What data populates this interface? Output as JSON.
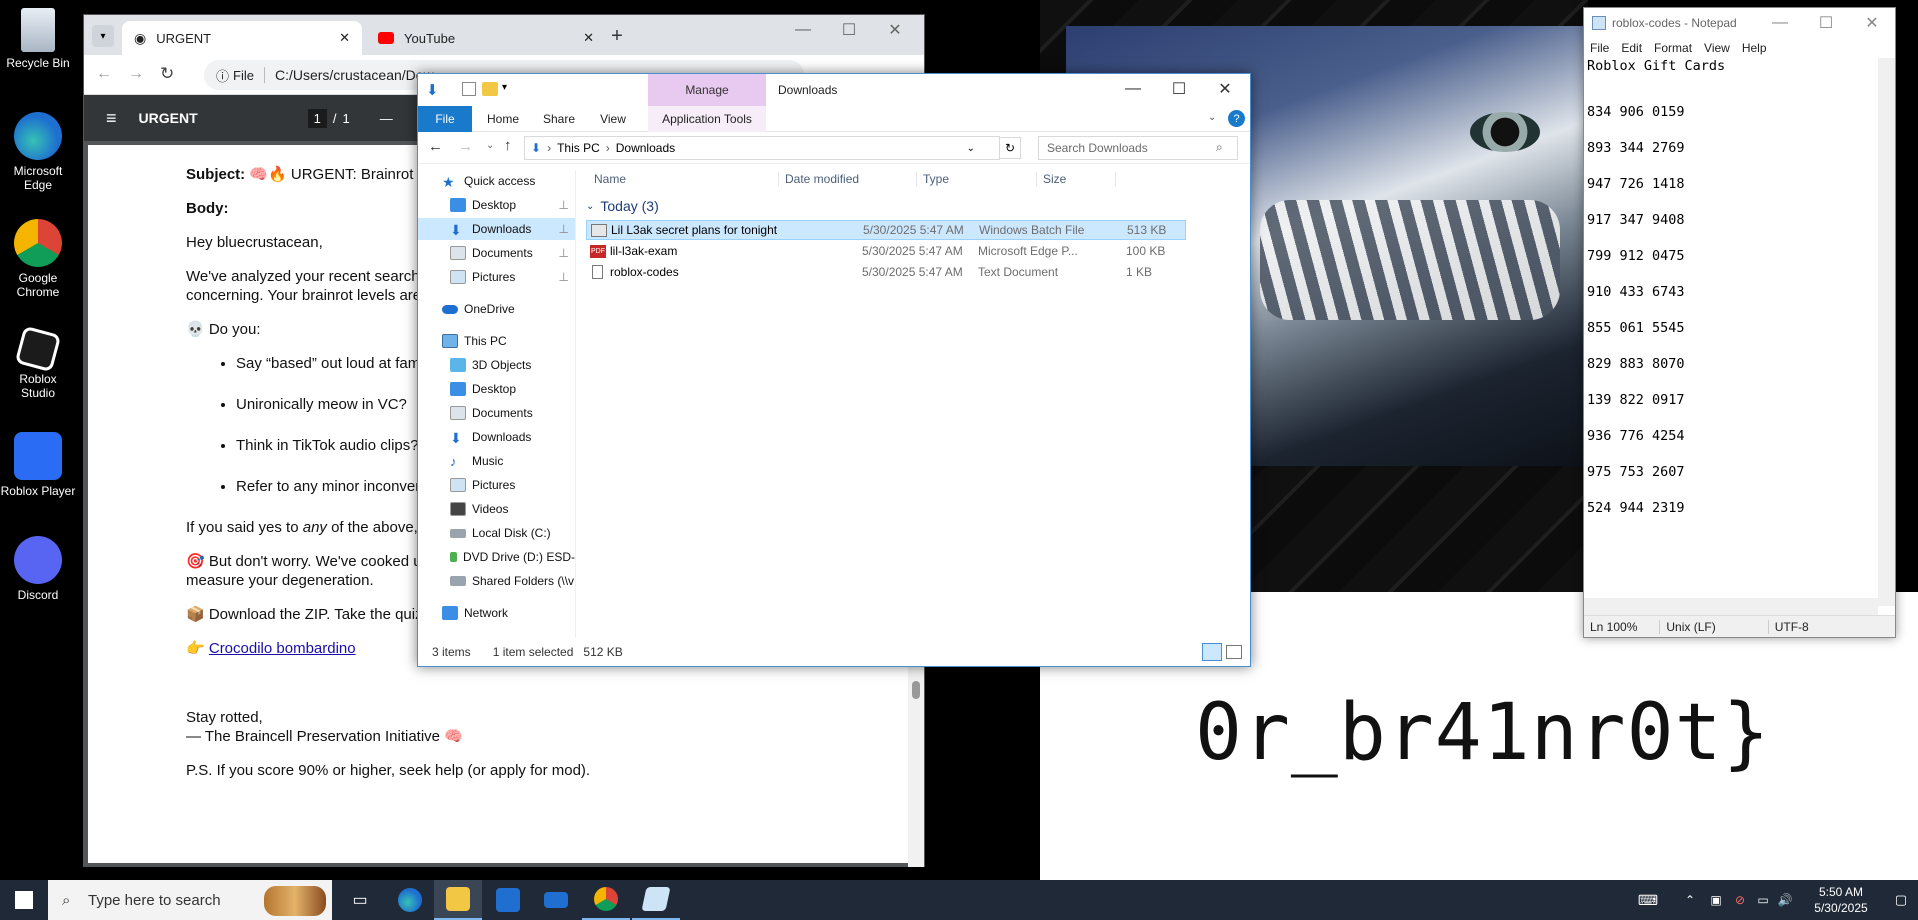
{
  "desktop": {
    "icons": [
      {
        "label": "Recycle Bin",
        "color": "#cfd8e3"
      },
      {
        "label": "Microsoft Edge",
        "color": "#1e90c8"
      },
      {
        "label": "Google Chrome",
        "color": "#db4437"
      },
      {
        "label": "Roblox Studio",
        "color": "#222222"
      },
      {
        "label": "Roblox Player",
        "color": "#2a6df4"
      },
      {
        "label": "Discord",
        "color": "#5865f2"
      }
    ],
    "wallpaper_text": "0r_br41nr0t}"
  },
  "browser": {
    "tabs": [
      {
        "label": "URGENT"
      },
      {
        "label": "YouTube"
      }
    ],
    "new_tab": "+",
    "address_scheme": "File",
    "address_url": "C:/Users/crustacean/Dow",
    "pdf": {
      "title": "URGENT",
      "page_current": "1",
      "page_sep": "/",
      "page_total": "1",
      "zoom_minus": "—",
      "subject_label": "Subject:",
      "subject_text": " 🧠🔥 URGENT: Brainrot L",
      "body_label": "Body:",
      "greeting": "Hey bluecrustacean,",
      "para1_line1": "We've analyzed your recent search",
      "para1_line2": "concerning. Your brainrot levels are",
      "do_you": "💀 Do you:",
      "bullets": [
        "Say “based” out loud at fami",
        "Unironically meow in VC?",
        "Think in TikTok audio clips?",
        "Refer to any minor inconven"
      ],
      "yes_prefix": "If you said yes to ",
      "yes_em": "any",
      "yes_suffix": " of the above, v",
      "worry_line1": "🎯 But don't worry. We've cooked up",
      "worry_line2": "measure your degeneration.",
      "download": "📦 Download the ZIP. Take the quiz",
      "link_prefix": "👉 ",
      "link_text": "Crocodilo bombardino",
      "signoff1": "Stay rotted,",
      "signoff2": "— The Braincell Preservation Initiative 🧠",
      "ps": "P.S. If you score 90% or higher, seek help (or apply for mod)."
    }
  },
  "explorer": {
    "title": "Downloads",
    "manage": "Manage",
    "ribbon_tabs": [
      "File",
      "Home",
      "Share",
      "View",
      "Application Tools"
    ],
    "breadcrumb": [
      "This PC",
      "Downloads"
    ],
    "search_placeholder": "Search Downloads",
    "nav": {
      "quick_access": "Quick access",
      "quick_items": [
        "Desktop",
        "Downloads",
        "Documents",
        "Pictures"
      ],
      "onedrive": "OneDrive",
      "this_pc": "This PC",
      "pc_items": [
        "3D Objects",
        "Desktop",
        "Documents",
        "Downloads",
        "Music",
        "Pictures",
        "Videos",
        "Local Disk (C:)",
        "DVD Drive (D:) ESD-",
        "Shared Folders (\\\\v"
      ],
      "network": "Network"
    },
    "columns": [
      "Name",
      "Date modified",
      "Type",
      "Size"
    ],
    "group": "Today (3)",
    "files": [
      {
        "name": "Lil L3ak secret plans for tonight",
        "date": "5/30/2025 5:47 AM",
        "type": "Windows Batch File",
        "size": "513 KB",
        "selected": true
      },
      {
        "name": "lil-l3ak-exam",
        "date": "5/30/2025 5:47 AM",
        "type": "Microsoft Edge P...",
        "size": "100 KB",
        "selected": false
      },
      {
        "name": "roblox-codes",
        "date": "5/30/2025 5:47 AM",
        "type": "Text Document",
        "size": "1 KB",
        "selected": false
      }
    ],
    "status_count": "3 items",
    "status_selected": "1 item selected",
    "status_size": "512 KB"
  },
  "notepad": {
    "title": "roblox-codes - Notepad",
    "menu": [
      "File",
      "Edit",
      "Format",
      "View",
      "Help"
    ],
    "heading": "Roblox Gift Cards",
    "codes": [
      "834 906 0159",
      "893 344 2769",
      "947 726 1418",
      "917 347 9408",
      "799 912 0475",
      "910 433 6743",
      "855 061 5545",
      "829 883 8070",
      "139 822 0917",
      "936 776 4254",
      "975 753 2607",
      "524 944 2319"
    ],
    "status_zoom": "Ln  100%",
    "status_eol": "Unix (LF)",
    "status_enc": "UTF-8"
  },
  "taskbar": {
    "search_placeholder": "Type here to search",
    "time": "5:50 AM",
    "date": "5/30/2025"
  }
}
